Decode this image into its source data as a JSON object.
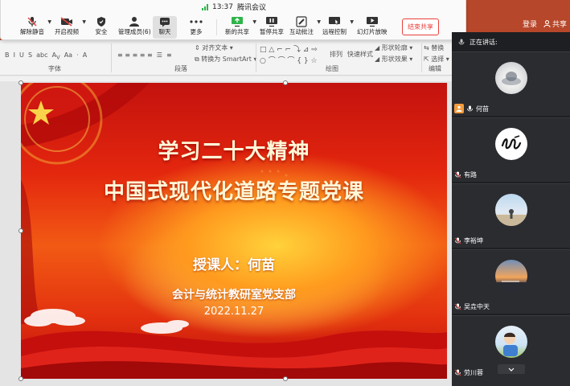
{
  "meeting": {
    "time": "13:37",
    "app_name": "腾讯会议",
    "toolbar": [
      {
        "label": "解除静音",
        "icon": "muted-mic-icon"
      },
      {
        "label": "开启视频",
        "icon": "video-off-icon"
      },
      {
        "label": "安全",
        "icon": "shield-icon"
      },
      {
        "label": "管理成员(6)",
        "icon": "members-icon"
      },
      {
        "label": "聊天",
        "icon": "chat-icon"
      },
      {
        "label": "更多",
        "icon": "more-icon"
      },
      {
        "label": "新的共享",
        "icon": "new-share-icon"
      },
      {
        "label": "暂停共享",
        "icon": "pause-share-icon"
      },
      {
        "label": "互动批注",
        "icon": "annotate-icon"
      },
      {
        "label": "远程控制",
        "icon": "remote-control-icon"
      },
      {
        "label": "幻灯片放映",
        "icon": "slideshow-icon"
      }
    ],
    "end_share_label": "结束共享"
  },
  "header_right": {
    "login_label": "登录",
    "share_label": "共享"
  },
  "ribbon": {
    "groups": [
      "字体",
      "段落",
      "绘图",
      "编辑"
    ],
    "para_row1": "对齐文本",
    "para_row2": "转换为 SmartArt",
    "arrange_label": "排列",
    "quick_style_label": "快速样式",
    "shape_outline_label": "形状轮廓",
    "shape_effect_label": "形状效果",
    "replace_label": "替换",
    "select_label": "选择"
  },
  "slide": {
    "title_line1": "学习二十大精神",
    "title_line2": "中国式现代化道路专题党课",
    "lecturer": "授课人：何苗",
    "department": "会计与统计教研室党支部",
    "date": "2022.11.27"
  },
  "panel": {
    "speaking_label": "正在讲话:",
    "participants": [
      {
        "name": "何苗",
        "host": true
      },
      {
        "name": "有路",
        "host": false
      },
      {
        "name": "李裕坤",
        "host": false
      },
      {
        "name": "吴垚中天",
        "host": false
      },
      {
        "name": "劳川蓉",
        "host": false
      }
    ]
  },
  "colors": {
    "accent_red": "#e9413c",
    "ppt_brand": "#b7472a",
    "signal_green": "#2fb44a"
  }
}
